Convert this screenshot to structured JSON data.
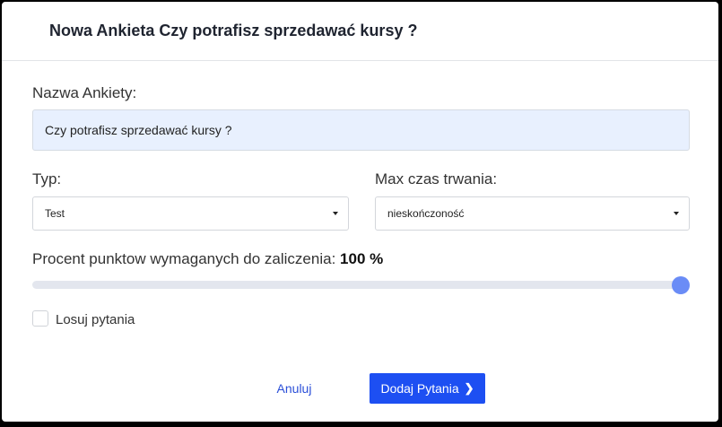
{
  "modal": {
    "title": "Nowa Ankieta Czy potrafisz sprzedawać kursy ?"
  },
  "form": {
    "name_label": "Nazwa Ankiety:",
    "name_value": "Czy potrafisz sprzedawać kursy ?",
    "type_label": "Typ:",
    "type_value": "Test",
    "duration_label": "Max czas trwania:",
    "duration_value": "nieskończoność",
    "pass_percent_label": "Procent punktow wymaganych do zaliczenia:",
    "pass_percent_value": "100 %",
    "pass_percent_fraction": 1.0,
    "shuffle_label": "Losuj pytania",
    "shuffle_checked": false
  },
  "footer": {
    "cancel_label": "Anuluj",
    "primary_label": "Dodaj Pytania",
    "primary_icon": "chevron-right-icon"
  },
  "colors": {
    "accent": "#1d4ff2",
    "slider_thumb": "#6a8cf6",
    "input_fill": "#e8f0fe"
  }
}
